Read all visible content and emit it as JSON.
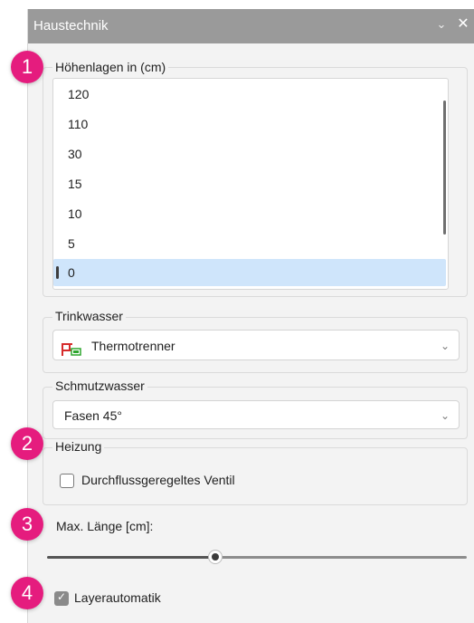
{
  "window": {
    "title": "Haustechnik",
    "collapse_icon": "chevron-down-icon",
    "close_icon": "close-icon"
  },
  "badges": [
    "1",
    "2",
    "3",
    "4"
  ],
  "heights": {
    "label": "Höhenlagen in (cm)",
    "items": [
      "120",
      "110",
      "30",
      "15",
      "10",
      "5",
      "0"
    ],
    "selected": "0"
  },
  "trinkwasser": {
    "label": "Trinkwasser",
    "value": "Thermotrenner",
    "icon": "thermotrenner-icon"
  },
  "schmutzwasser": {
    "label": "Schmutzwasser",
    "value": "Fasen 45°"
  },
  "heizung": {
    "label": "Heizung",
    "checkbox_label": "Durchflussgeregeltes Ventil",
    "checked": false
  },
  "max_length": {
    "label": "Max. Länge [cm]:",
    "slider_fraction": 0.4
  },
  "layer": {
    "label": "Layerautomatik",
    "checked": true
  },
  "colors": {
    "accent_badge": "#e51c7e",
    "selection": "#cfe5fb",
    "titlebar": "#9a9a9a"
  }
}
